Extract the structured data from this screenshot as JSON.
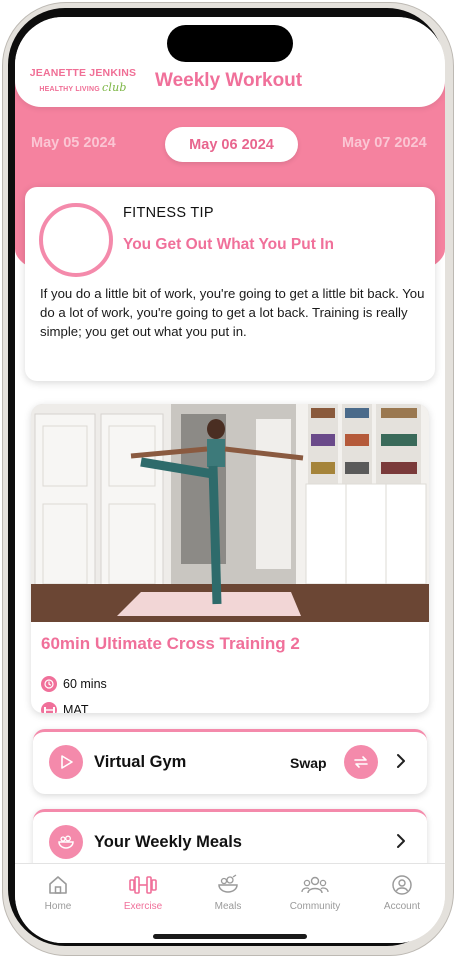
{
  "brand": {
    "line1": "JEANETTE JENKINS",
    "line2": "HEALTHY LIVING",
    "club": "club"
  },
  "header": {
    "title": "Weekly Workout"
  },
  "dates": {
    "prev": "May 05 2024",
    "current": "May 06 2024",
    "next": "May 07 2024"
  },
  "tip": {
    "label": "FITNESS TIP",
    "heading": "You Get Out What You Put In",
    "body": "If you do a little bit of work, you're going to get a little bit back. You do a lot of work, you're going to get a lot back. Training is really simple; you get out what you put in."
  },
  "workout": {
    "title": "60min Ultimate Cross Training 2",
    "duration": "60 mins",
    "equipment": "MAT"
  },
  "actions": {
    "virtual_gym": "Virtual Gym",
    "swap": "Swap",
    "meals": "Your Weekly Meals"
  },
  "tabs": [
    {
      "label": "Home",
      "icon": "home-icon"
    },
    {
      "label": "Exercise",
      "icon": "dumbbell-icon"
    },
    {
      "label": "Meals",
      "icon": "salad-bowl-icon"
    },
    {
      "label": "Community",
      "icon": "people-icon"
    },
    {
      "label": "Account",
      "icon": "user-circle-icon"
    }
  ],
  "colors": {
    "accent": "#f0709a",
    "band": "#f5829f",
    "logo_green": "#7ab542"
  }
}
